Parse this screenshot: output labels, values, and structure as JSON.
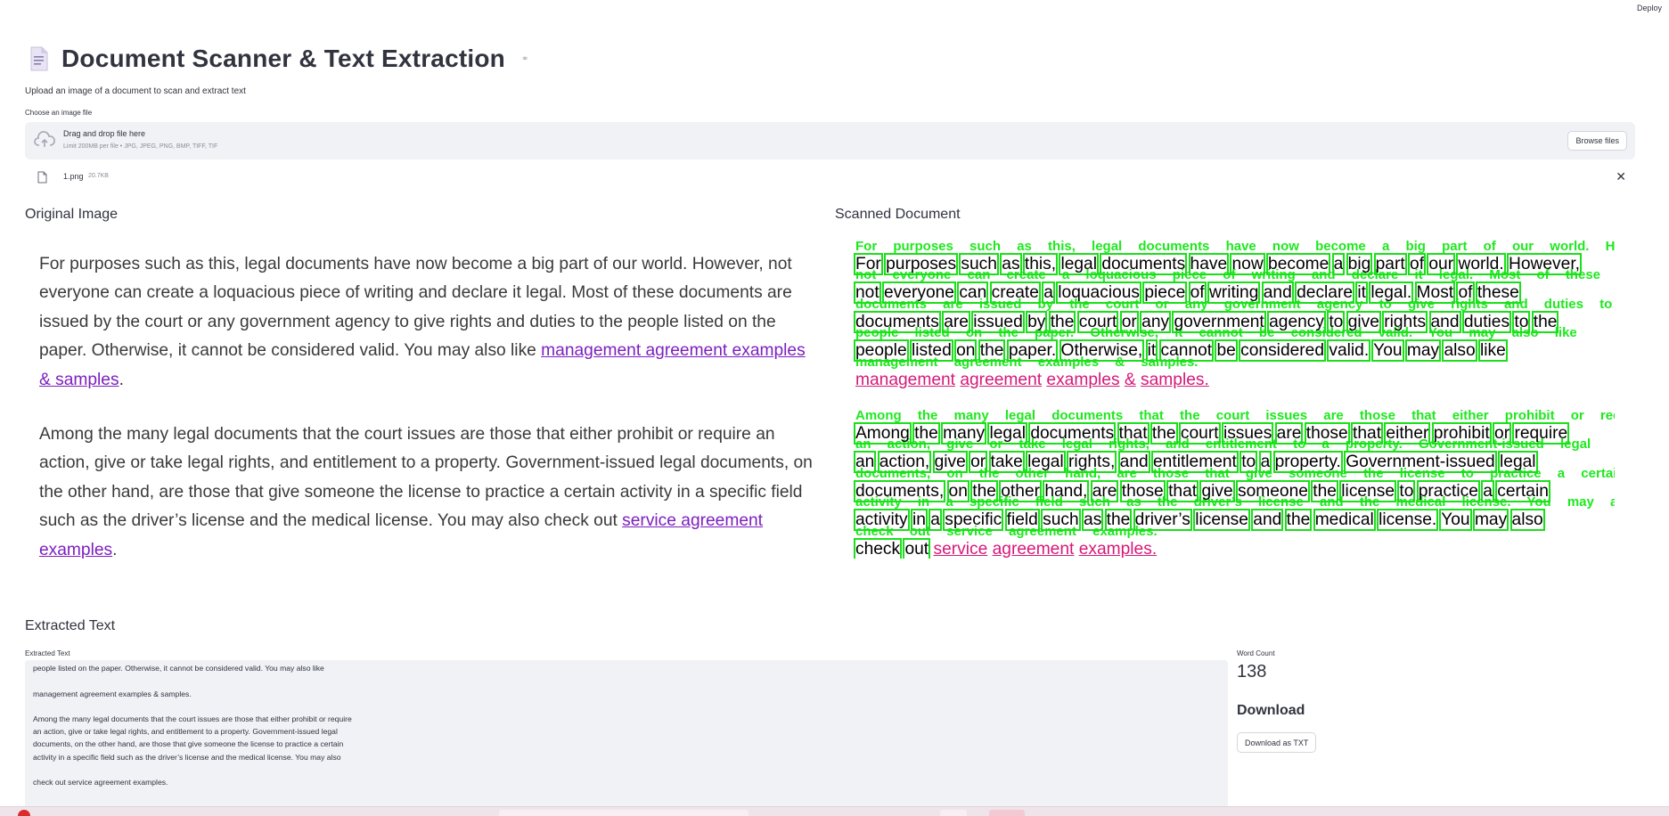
{
  "header": {
    "deploy_label": "Deploy"
  },
  "title": {
    "text": "Document Scanner & Text Extraction",
    "icon": "document-icon"
  },
  "subtitle": "Upload an image of a document to scan and extract text",
  "uploader": {
    "label": "Choose an image file",
    "drop_text": "Drag and drop file here",
    "limit_text": "Limit 200MB per file • JPG, JPEG, PNG, BMP, TIFF, TIF",
    "browse_label": "Browse files"
  },
  "file": {
    "name": "1.png",
    "size": "20.7KB"
  },
  "original": {
    "heading": "Original Image",
    "p1": "For purposes such as this, legal documents have now become a big part of our world. However, not everyone can create a loquacious piece of writing and declare it legal. Most of these documents are issued by the court or any government agency to give rights and duties to the people listed on the paper. Otherwise, it cannot be considered valid. You may also like ",
    "p1_link": "management agreement examples & samples",
    "p2": "Among the many legal documents that the court issues are those that either prohibit or require an action, give or take legal rights, and entitlement to a property. Government-issued legal documents, on the other hand, are those that give someone the license to practice a certain activity in a specific field such as the driver’s license and the medical license. You may also check out ",
    "p2_link": "service agreement examples",
    "period": "."
  },
  "scanned": {
    "heading": "Scanned Document",
    "lines": [
      "For purposes such as this, legal documents have now become a big part of our world. However,",
      "not everyone can create a loquacious piece of writing and declare it legal. Most of these",
      "documents are issued by the court or any government agency to give rights and duties to the",
      "people listed on the paper. Otherwise, it cannot be considered valid. You may also like"
    ],
    "link1": "management agreement examples & samples.",
    "lines2": [
      "Among the many legal documents that the court issues are those that either prohibit or require",
      "an action, give or take legal rights, and entitlement to a property. Government-issued legal",
      "documents, on the other hand, are those that give someone the license to practice a certain",
      "activity in a specific field such as the driver’s license and the medical license. You may also"
    ],
    "last_prefix": "check out ",
    "link2": "service agreement examples."
  },
  "extracted": {
    "heading": "Extracted Text",
    "label": "Extracted Text",
    "content": "documents are issued by the court or any government agency to give rights and duties to the\npeople listed on the paper. Otherwise, it cannot be considered valid. You may also like\n\nmanagement agreement examples & samples.\n\nAmong the many legal documents that the court issues are those that either prohibit or require\nan action, give or take legal rights, and entitlement to a property. Government-issued legal\ndocuments, on the other hand, are those that give someone the license to practice a certain\nactivity in a specific field such as the driver’s license and the medical license. You may also\n\ncheck out service agreement examples."
  },
  "stats": {
    "word_count_label": "Word Count",
    "word_count": "138"
  },
  "download": {
    "heading": "Download",
    "button_label": "Download as TXT"
  },
  "colors": {
    "accent_green": "#1ee81e",
    "link_purple": "#7d1fbf",
    "link_pink": "#d6197a",
    "panel_bg": "#f0f2f6"
  }
}
